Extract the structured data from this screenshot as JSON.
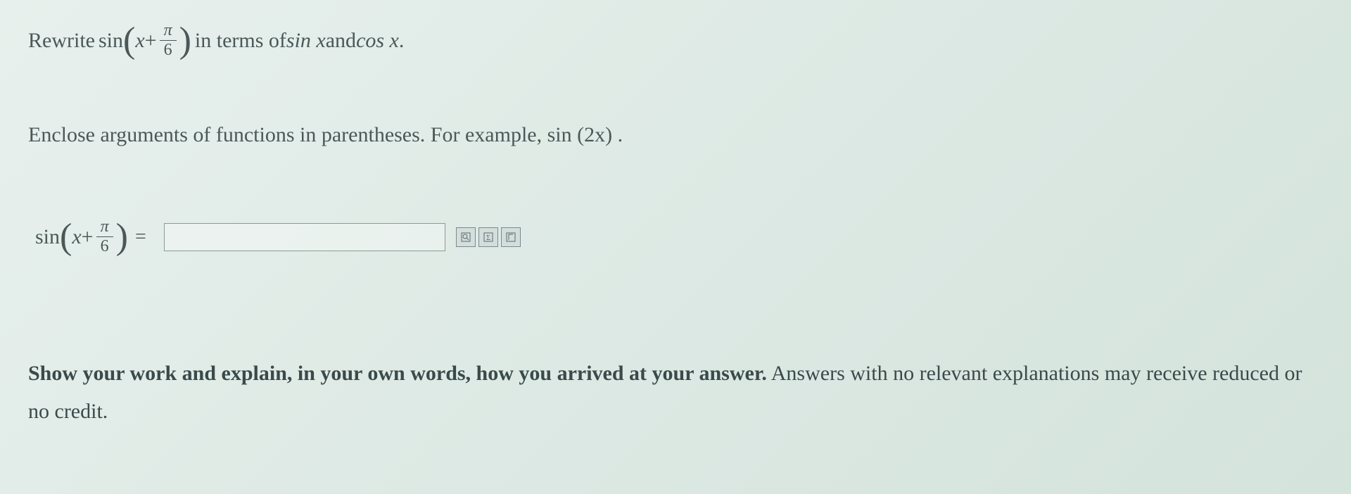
{
  "problem": {
    "prefix": "Rewrite ",
    "func": "sin",
    "arg_var": "x",
    "arg_op": " + ",
    "frac_num": "π",
    "frac_den": "6",
    "suffix1": " in terms of ",
    "sinx": "sin x",
    "and": " and ",
    "cosx": "cos x",
    "period": "."
  },
  "hint": {
    "text1": "Enclose arguments of functions in parentheses. For example, ",
    "example": "sin (2x)",
    "period": "."
  },
  "answer": {
    "func": "sin",
    "arg_var": "x",
    "arg_op": " + ",
    "frac_num": "π",
    "frac_den": "6",
    "equals": "=",
    "input_value": ""
  },
  "icons": {
    "preview": "⍰",
    "sigma": "Σ",
    "help": "?"
  },
  "instructions": {
    "bold_text": "Show your work and explain, in your own words, how you arrived at your answer.",
    "rest": " Answers with no relevant explanations may receive reduced or no credit."
  }
}
